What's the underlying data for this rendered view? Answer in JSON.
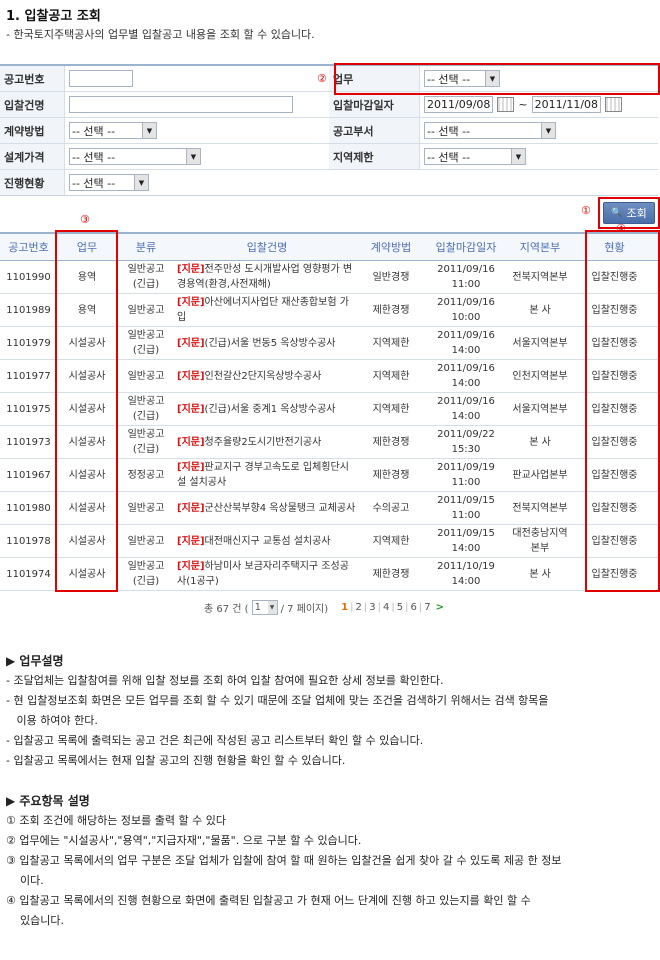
{
  "page": {
    "title": "1. 입찰공고 조회",
    "subtitle": "- 한국토지주택공사의 업무별 입찰공고 내용을 조회 할 수 있습니다."
  },
  "form": {
    "notice_no_label": "공고번호",
    "notice_no_value": "",
    "work_label": "업무",
    "work_value": "-- 선택 --",
    "bid_name_label": "입찰건명",
    "bid_name_value": "",
    "deadline_label": "입찰마감일자",
    "date_from": "2011/09/08",
    "date_sep": "~",
    "date_to": "2011/11/08",
    "contract_label": "계약방법",
    "contract_value": "-- 선택 --",
    "dept_label": "공고부서",
    "dept_value": "-- 선택 --",
    "price_label": "설계가격",
    "price_value": "-- 선택 --",
    "region_label": "지역제한",
    "region_value": "-- 선택 --",
    "status_label": "진행현황",
    "status_value": "-- 선택 --"
  },
  "markers": {
    "m1": "①",
    "m2": "②",
    "m3": "③",
    "m4": "④"
  },
  "search_button": "조회",
  "table": {
    "headers": [
      "공고번호",
      "업무",
      "분류",
      "입찰건명",
      "계약방법",
      "입찰마감일자",
      "지역본부",
      "현황"
    ],
    "rows": [
      {
        "no": "1101990",
        "work": "용역",
        "cat": "일반공고\n(긴급)",
        "tag": "[지문]",
        "name": "전주만성 도시개발사업 영향평가 변경용역(환경,사전재해)",
        "contract": "일반경쟁",
        "deadline": "2011/09/16 11:00",
        "region": "전북지역본부",
        "status": "입찰진행중"
      },
      {
        "no": "1101989",
        "work": "용역",
        "cat": "일반공고",
        "tag": "[지문]",
        "name": "아산에너지사업단 재산종합보험 가입",
        "contract": "제한경쟁",
        "deadline": "2011/09/16 10:00",
        "region": "본 사",
        "status": "입찰진행중"
      },
      {
        "no": "1101979",
        "work": "시설공사",
        "cat": "일반공고\n(긴급)",
        "tag": "[지문]",
        "name": "(긴급)서울 번동5 옥상방수공사",
        "contract": "지역제한",
        "deadline": "2011/09/16 14:00",
        "region": "서울지역본부",
        "status": "입찰진행중"
      },
      {
        "no": "1101977",
        "work": "시설공사",
        "cat": "일반공고",
        "tag": "[지문]",
        "name": "인천갈산2단지옥상방수공사",
        "contract": "지역제한",
        "deadline": "2011/09/16 14:00",
        "region": "인천지역본부",
        "status": "입찰진행중"
      },
      {
        "no": "1101975",
        "work": "시설공사",
        "cat": "일반공고\n(긴급)",
        "tag": "[지문]",
        "name": "(긴급)서울 중계1 옥상방수공사",
        "contract": "지역제한",
        "deadline": "2011/09/16 14:00",
        "region": "서울지역본부",
        "status": "입찰진행중"
      },
      {
        "no": "1101973",
        "work": "시설공사",
        "cat": "일반공고\n(긴급)",
        "tag": "[지문]",
        "name": "청주율량2도시기반전기공사",
        "contract": "제한경쟁",
        "deadline": "2011/09/22 15:30",
        "region": "본 사",
        "status": "입찰진행중"
      },
      {
        "no": "1101967",
        "work": "시설공사",
        "cat": "정정공고",
        "tag": "[지문]",
        "name": "판교지구 경부고속도로 입체횡단시설 설치공사",
        "contract": "제한경쟁",
        "deadline": "2011/09/19 11:00",
        "region": "판교사업본부",
        "status": "입찰진행중"
      },
      {
        "no": "1101980",
        "work": "시설공사",
        "cat": "일반공고",
        "tag": "[지문]",
        "name": "군산산북부향4 옥상물탱크 교체공사",
        "contract": "수의공고",
        "deadline": "2011/09/15 11:00",
        "region": "전북지역본부",
        "status": "입찰진행중"
      },
      {
        "no": "1101978",
        "work": "시설공사",
        "cat": "일반공고",
        "tag": "[지문]",
        "name": "대전매신지구 교통섬 설치공사",
        "contract": "지역제한",
        "deadline": "2011/09/15 14:00",
        "region": "대전충남지역본부",
        "status": "입찰진행중"
      },
      {
        "no": "1101974",
        "work": "시설공사",
        "cat": "일반공고\n(긴급)",
        "tag": "[지문]",
        "name": "하남미사 보금자리주택지구 조성공사(1공구)",
        "contract": "제한경쟁",
        "deadline": "2011/10/19 14:00",
        "region": "본 사",
        "status": "입찰진행중"
      }
    ]
  },
  "pager": {
    "total_prefix": "총 67 건 (",
    "page_select": "1",
    "total_suffix": "/ 7 페이지)",
    "pages": [
      "1",
      "2",
      "3",
      "4",
      "5",
      "6",
      "7"
    ],
    "current": "1",
    "next": ">"
  },
  "desc1": {
    "heading": "▶ 업무설명",
    "lines": [
      "- 조달업체는 입찰참여를 위해 입찰 정보를 조회 하여 입찰 참여에 필요한 상세 정보를 확인한다.",
      "- 현 입찰정보조회 화면은 모든 업무를 조회 할 수 있기 때문에 조달 업체에 맞는 조건을 검색하기 위해서는 검색 항목을",
      "   이용 하여야 한다.",
      "- 입찰공고 목록에 출력되는 공고 건은 최근에 작성된 공고 리스트부터 확인 할 수 있습니다.",
      "- 입찰공고 목록에서는 현재 입찰 공고의 진행 현황을 확인 할 수 있습니다."
    ]
  },
  "desc2": {
    "heading": "▶ 주요항목 설명",
    "lines": [
      "① 조회 조건에 해당하는 정보를 출력 할 수 있다",
      "② 업무에는 \"시설공사\",\"용역\",\"지급자재\",\"물품\". 으로 구분 할 수 있습니다.",
      "③ 입찰공고 목록에서의 업무 구분은 조달 업체가 입찰에 참여 할 때 원하는 입찰건을 쉽게 찾아 갈 수 있도록 제공 한 정보",
      "    이다.",
      "④ 입찰공고 목록에서의 진행 현황으로 화면에 출력된 입찰공고 가 현재 어느 단계에 진행 하고 있는지를 확인 할 수",
      "    있습니다."
    ]
  },
  "colors": {
    "accent_red": "#e00000",
    "header_blue": "#4d6fb5",
    "tag_red": "#d11111",
    "button_blue": "#4a6ea8"
  }
}
